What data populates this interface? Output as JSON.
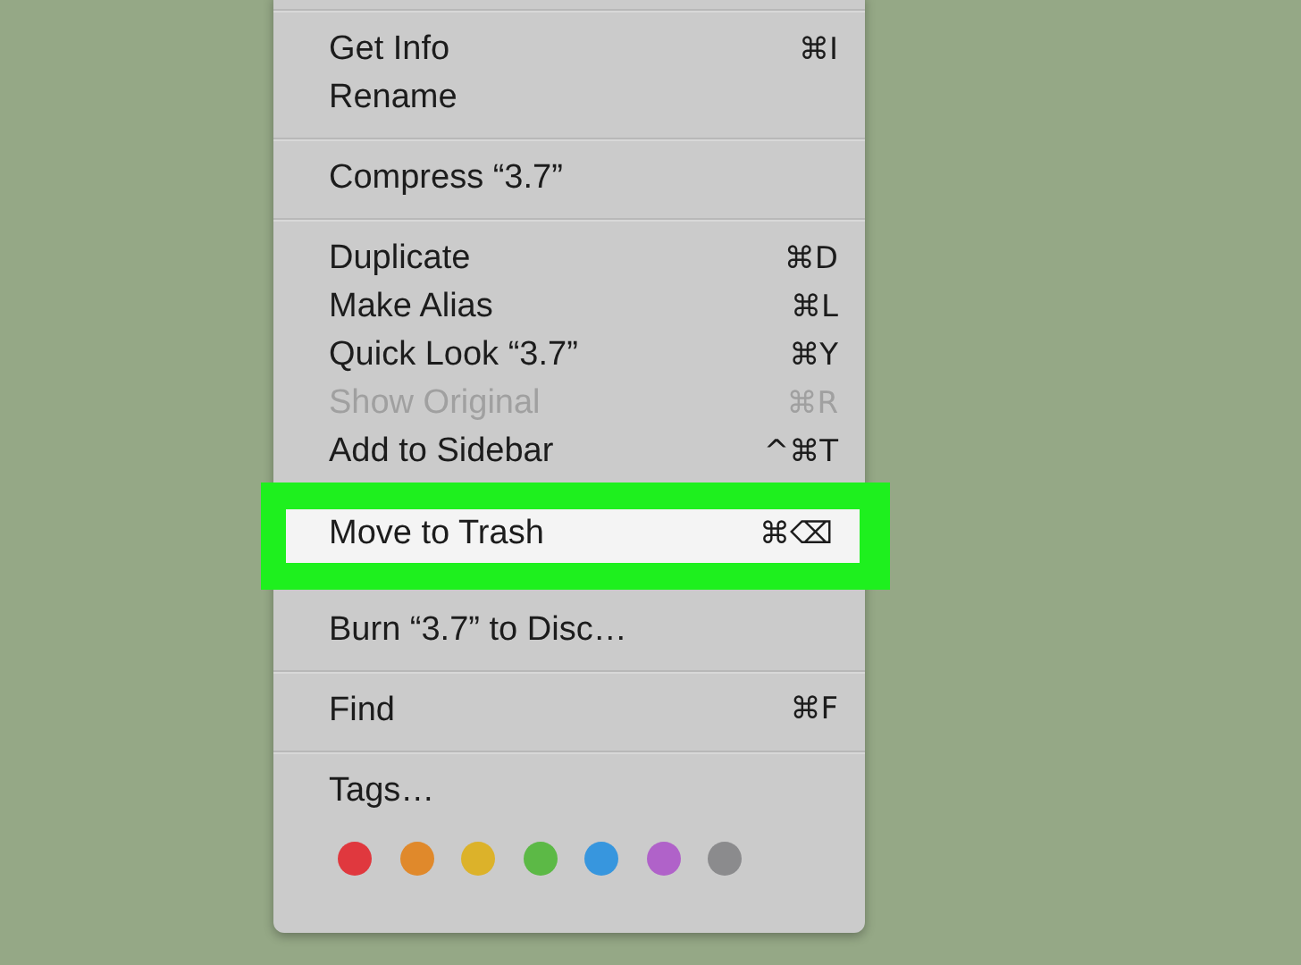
{
  "context_menu": {
    "items": [
      {
        "kind": "separator"
      },
      {
        "kind": "item",
        "label": "Get Info",
        "shortcut": "⌘I",
        "disabled": false,
        "selected": false
      },
      {
        "kind": "item",
        "label": "Rename",
        "disabled": false,
        "selected": false
      },
      {
        "kind": "separator"
      },
      {
        "kind": "item",
        "label": "Compress “3.7”",
        "disabled": false,
        "selected": false
      },
      {
        "kind": "separator"
      },
      {
        "kind": "item",
        "label": "Duplicate",
        "shortcut": "⌘D",
        "disabled": false,
        "selected": false
      },
      {
        "kind": "item",
        "label": "Make Alias",
        "shortcut": "⌘L",
        "disabled": false,
        "selected": false
      },
      {
        "kind": "item",
        "label": "Quick Look “3.7”",
        "shortcut": "⌘Y",
        "disabled": false,
        "selected": false
      },
      {
        "kind": "item",
        "label": "Show Original",
        "shortcut": "⌘R",
        "disabled": true,
        "selected": false
      },
      {
        "kind": "item",
        "label": "Add to Sidebar",
        "shortcut": "^⌘T",
        "disabled": false,
        "selected": false
      },
      {
        "kind": "item",
        "label": "Move to Trash",
        "shortcut": "⌘⌫",
        "disabled": false,
        "selected": true
      },
      {
        "kind": "item",
        "label": "Burn “3.7” to Disc…",
        "disabled": false,
        "selected": false
      },
      {
        "kind": "separator"
      },
      {
        "kind": "item",
        "label": "Find",
        "shortcut": "⌘F",
        "disabled": false,
        "selected": false
      },
      {
        "kind": "separator"
      },
      {
        "kind": "item",
        "label": "Tags…",
        "disabled": false,
        "selected": false
      },
      {
        "kind": "tags",
        "colors": [
          {
            "color": "#e0383e"
          },
          {
            "color": "#e0892b"
          },
          {
            "color": "#dcb22a"
          },
          {
            "color": "#5cb946"
          },
          {
            "color": "#3796de"
          },
          {
            "color": "#b062c9"
          },
          {
            "color": "#8b8b8d"
          }
        ]
      }
    ]
  }
}
